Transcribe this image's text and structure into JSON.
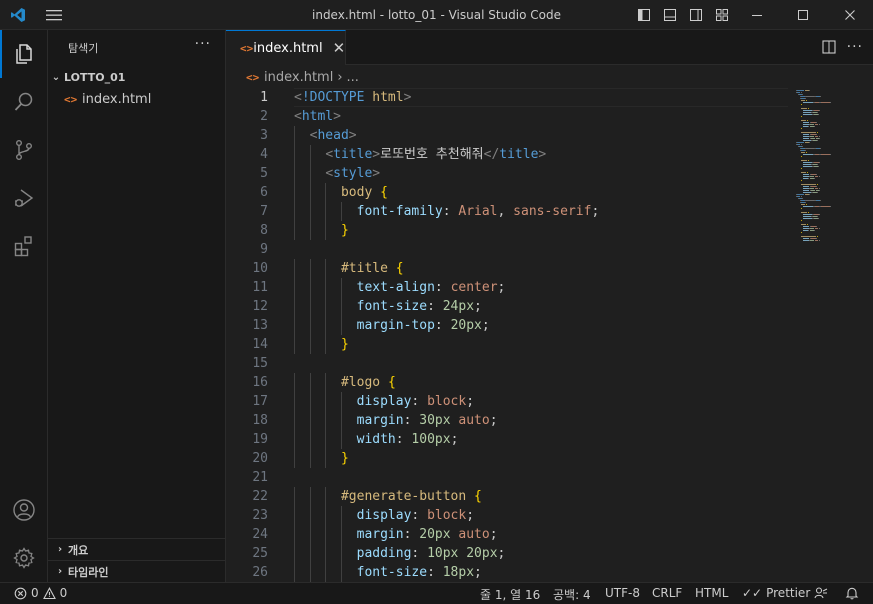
{
  "window": {
    "title": "index.html - lotto_01 - Visual Studio Code"
  },
  "icons": {
    "app": "vscode-logo-icon",
    "menu": "hamburger-menu-icon",
    "explorer": "files-icon",
    "search": "search-icon",
    "source_control": "source-control-icon",
    "run_debug": "run-debug-icon",
    "extensions": "extensions-icon",
    "account": "account-icon",
    "settings": "gear-icon"
  },
  "colors": {
    "accent": "#0078d4",
    "html_icon": "#e37933",
    "tag": "#569cd6",
    "selector": "#d7ba7d",
    "property": "#9cdcfe",
    "string_value": "#ce9178",
    "number_value": "#b5cea8",
    "brace": "#ffd700"
  },
  "sidebar": {
    "title": "탐색기",
    "more": "···",
    "folder": "LOTTO_01",
    "files": [
      "index.html"
    ],
    "sections": [
      "개요",
      "타임라인"
    ]
  },
  "editor": {
    "tab_label": "index.html",
    "breadcrumb_file": "index.html",
    "breadcrumb_more": "...",
    "current_line": 1
  },
  "code_lines": [
    [
      [
        "punc",
        "<"
      ],
      [
        "doc",
        "!DOCTYPE"
      ],
      [
        "text",
        " "
      ],
      [
        "sel",
        "html"
      ],
      [
        "punc",
        ">"
      ]
    ],
    [
      [
        "punc",
        "<"
      ],
      [
        "tag",
        "html"
      ],
      [
        "punc",
        ">"
      ]
    ],
    [
      [
        "text",
        "  "
      ],
      [
        "punc",
        "<"
      ],
      [
        "tag",
        "head"
      ],
      [
        "punc",
        ">"
      ]
    ],
    [
      [
        "text",
        "    "
      ],
      [
        "punc",
        "<"
      ],
      [
        "tag",
        "title"
      ],
      [
        "punc",
        ">"
      ],
      [
        "text",
        "로또번호 추천해줘"
      ],
      [
        "punc",
        "</"
      ],
      [
        "tag",
        "title"
      ],
      [
        "punc",
        ">"
      ]
    ],
    [
      [
        "text",
        "    "
      ],
      [
        "punc",
        "<"
      ],
      [
        "tag",
        "style"
      ],
      [
        "punc",
        ">"
      ]
    ],
    [
      [
        "text",
        "      "
      ],
      [
        "sel",
        "body"
      ],
      [
        "text",
        " "
      ],
      [
        "brace",
        "{"
      ]
    ],
    [
      [
        "text",
        "        "
      ],
      [
        "prop",
        "font-family"
      ],
      [
        "text",
        ": "
      ],
      [
        "val",
        "Arial"
      ],
      [
        "text",
        ", "
      ],
      [
        "val",
        "sans-serif"
      ],
      [
        "text",
        ";"
      ]
    ],
    [
      [
        "text",
        "      "
      ],
      [
        "brace",
        "}"
      ]
    ],
    [],
    [
      [
        "text",
        "      "
      ],
      [
        "sel",
        "#title"
      ],
      [
        "text",
        " "
      ],
      [
        "brace",
        "{"
      ]
    ],
    [
      [
        "text",
        "        "
      ],
      [
        "prop",
        "text-align"
      ],
      [
        "text",
        ": "
      ],
      [
        "val",
        "center"
      ],
      [
        "text",
        ";"
      ]
    ],
    [
      [
        "text",
        "        "
      ],
      [
        "prop",
        "font-size"
      ],
      [
        "text",
        ": "
      ],
      [
        "num",
        "24px"
      ],
      [
        "text",
        ";"
      ]
    ],
    [
      [
        "text",
        "        "
      ],
      [
        "prop",
        "margin-top"
      ],
      [
        "text",
        ": "
      ],
      [
        "num",
        "20px"
      ],
      [
        "text",
        ";"
      ]
    ],
    [
      [
        "text",
        "      "
      ],
      [
        "brace",
        "}"
      ]
    ],
    [],
    [
      [
        "text",
        "      "
      ],
      [
        "sel",
        "#logo"
      ],
      [
        "text",
        " "
      ],
      [
        "brace",
        "{"
      ]
    ],
    [
      [
        "text",
        "        "
      ],
      [
        "prop",
        "display"
      ],
      [
        "text",
        ": "
      ],
      [
        "val",
        "block"
      ],
      [
        "text",
        ";"
      ]
    ],
    [
      [
        "text",
        "        "
      ],
      [
        "prop",
        "margin"
      ],
      [
        "text",
        ": "
      ],
      [
        "num",
        "30px"
      ],
      [
        "text",
        " "
      ],
      [
        "val",
        "auto"
      ],
      [
        "text",
        ";"
      ]
    ],
    [
      [
        "text",
        "        "
      ],
      [
        "prop",
        "width"
      ],
      [
        "text",
        ": "
      ],
      [
        "num",
        "100px"
      ],
      [
        "text",
        ";"
      ]
    ],
    [
      [
        "text",
        "      "
      ],
      [
        "brace",
        "}"
      ]
    ],
    [],
    [
      [
        "text",
        "      "
      ],
      [
        "sel",
        "#generate-button"
      ],
      [
        "text",
        " "
      ],
      [
        "brace",
        "{"
      ]
    ],
    [
      [
        "text",
        "        "
      ],
      [
        "prop",
        "display"
      ],
      [
        "text",
        ": "
      ],
      [
        "val",
        "block"
      ],
      [
        "text",
        ";"
      ]
    ],
    [
      [
        "text",
        "        "
      ],
      [
        "prop",
        "margin"
      ],
      [
        "text",
        ": "
      ],
      [
        "num",
        "20px"
      ],
      [
        "text",
        " "
      ],
      [
        "val",
        "auto"
      ],
      [
        "text",
        ";"
      ]
    ],
    [
      [
        "text",
        "        "
      ],
      [
        "prop",
        "padding"
      ],
      [
        "text",
        ": "
      ],
      [
        "num",
        "10px"
      ],
      [
        "text",
        " "
      ],
      [
        "num",
        "20px"
      ],
      [
        "text",
        ";"
      ]
    ],
    [
      [
        "text",
        "        "
      ],
      [
        "prop",
        "font-size"
      ],
      [
        "text",
        ": "
      ],
      [
        "num",
        "18px"
      ],
      [
        "text",
        ";"
      ]
    ]
  ],
  "statusbar": {
    "errors": "0",
    "warnings": "0",
    "position": "줄 1, 열 16",
    "spaces": "공백: 4",
    "encoding": "UTF-8",
    "eol": "CRLF",
    "language": "HTML",
    "prettier": "Prettier"
  }
}
